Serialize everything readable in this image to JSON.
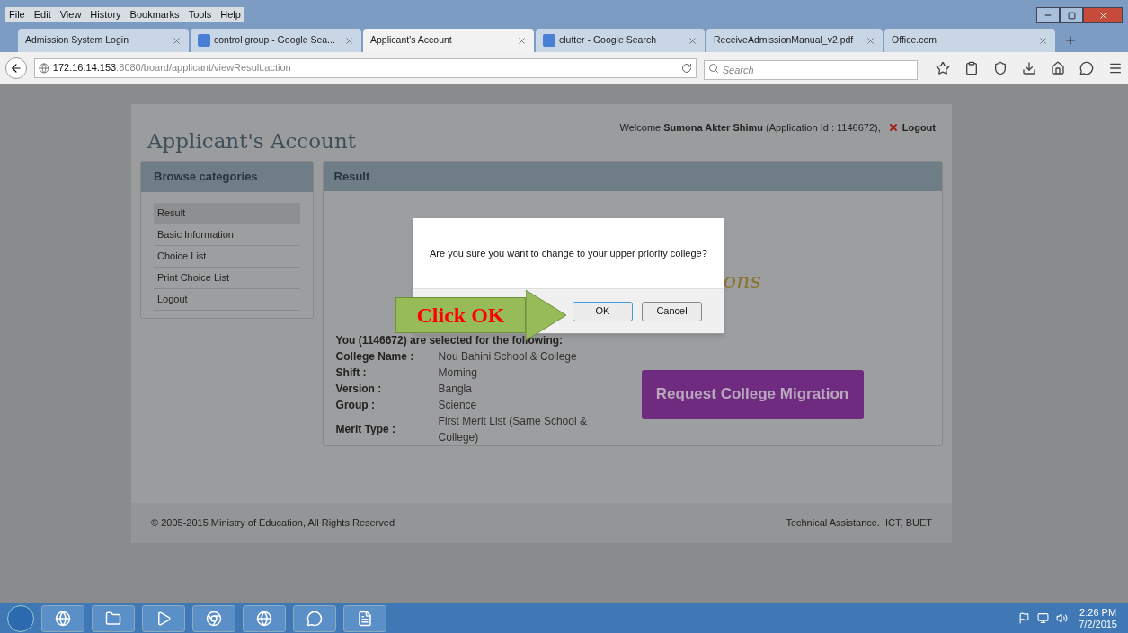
{
  "browser": {
    "menu": [
      "File",
      "Edit",
      "View",
      "History",
      "Bookmarks",
      "Tools",
      "Help"
    ],
    "tabs": [
      {
        "title": "Admission System Login",
        "icon": false,
        "selected": false
      },
      {
        "title": "control group - Google Sea...",
        "icon": true,
        "selected": false
      },
      {
        "title": "Applicant's Account",
        "icon": false,
        "selected": true
      },
      {
        "title": "clutter - Google Search",
        "icon": true,
        "selected": false
      },
      {
        "title": "ReceiveAdmissionManual_v2.pdf",
        "icon": false,
        "selected": false
      },
      {
        "title": "Office.com",
        "icon": false,
        "selected": false
      }
    ],
    "address": {
      "host": "172.16.14.153",
      "path": ":8080/board/applicant/viewResult.action"
    },
    "search": {
      "placeholder": "Search"
    }
  },
  "page": {
    "title": "Applicant's Account",
    "welcome": "Welcome **Sumona Akter Shimu** (Application Id : 1146672),",
    "logout": "Logout",
    "sidebar": {
      "heading": "Browse categories",
      "items": [
        {
          "label": "Result",
          "selected": true
        },
        {
          "label": "Basic Information",
          "selected": false
        },
        {
          "label": "Choice List",
          "selected": false
        },
        {
          "label": "Print Choice List",
          "selected": false
        },
        {
          "label": "Logout",
          "selected": false
        }
      ]
    },
    "result": {
      "heading": "Result",
      "logo_fragment": "ons",
      "selection_heading": "You (1146672) are selected for the following:",
      "details": [
        {
          "label": "College Name :",
          "value": "Nou Bahini School & College"
        },
        {
          "label": "Shift :",
          "value": "Morning"
        },
        {
          "label": "Version :",
          "value": "Bangla"
        },
        {
          "label": "Group :",
          "value": "Science"
        },
        {
          "label": "Merit Type :",
          "value": "First Merit List (Same School & College)"
        }
      ],
      "migration_button": "Request College Migration"
    },
    "footer": {
      "left": "© 2005-2015 Ministry of Education, All Rights Reserved",
      "right": "Technical Assistance. IICT, BUET"
    }
  },
  "dialog": {
    "message": "Are you sure you want to change to your upper priority college?",
    "buttons": [
      {
        "label": "OK",
        "selected": true
      },
      {
        "label": "Cancel",
        "selected": false
      }
    ]
  },
  "callout": {
    "text": "Click OK"
  },
  "taskbar": {
    "time": "2:26 PM",
    "date": "7/2/2015"
  }
}
